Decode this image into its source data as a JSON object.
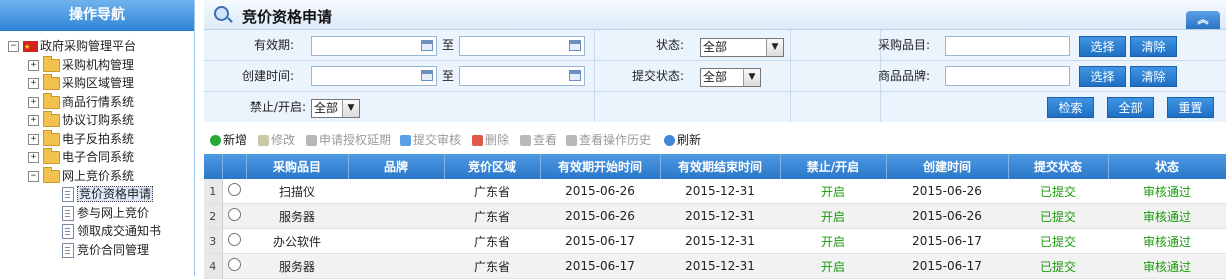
{
  "sidebar": {
    "title": "操作导航",
    "root": "政府采购管理平台",
    "items": [
      {
        "label": "采购机构管理"
      },
      {
        "label": "采购区域管理"
      },
      {
        "label": "商品行情系统"
      },
      {
        "label": "协议订购系统"
      },
      {
        "label": "电子反拍系统"
      },
      {
        "label": "电子合同系统"
      },
      {
        "label": "网上竞价系统"
      }
    ],
    "subitems": [
      {
        "label": "竞价资格申请"
      },
      {
        "label": "参与网上竞价"
      },
      {
        "label": "领取成交通知书"
      },
      {
        "label": "竞价合同管理"
      }
    ]
  },
  "header": {
    "title": "竞价资格申请",
    "collapse": "︽"
  },
  "form": {
    "valid_label": "有效期:",
    "to1": "至",
    "to2": "至",
    "status_label": "状态:",
    "status_value": "全部",
    "item_label": "采购品目:",
    "select_btn": "选择",
    "clear_btn": "清除",
    "created_label": "创建时间:",
    "submit_status_label": "提交状态:",
    "submit_status_value": "全部",
    "brand_label": "商品品牌:",
    "select_btn2": "选择",
    "clear_btn2": "清除",
    "toggle_label": "禁止/开启:",
    "toggle_value": "全部",
    "search_btn": "检索",
    "all_btn": "全部",
    "reset_btn": "重置"
  },
  "toolbar": {
    "add": "新增",
    "edit": "修改",
    "extend": "申请授权延期",
    "submit": "提交审核",
    "delete": "删除",
    "view": "查看",
    "history": "查看操作历史",
    "refresh": "刷新"
  },
  "table": {
    "headers": [
      "采购品目",
      "品牌",
      "竞价区域",
      "有效期开始时间",
      "有效期结束时间",
      "禁止/开启",
      "创建时间",
      "提交状态",
      "状态"
    ],
    "rows": [
      {
        "n": "1",
        "item": "扫描仪",
        "brand": "",
        "region": "广东省",
        "start": "2015-06-26",
        "end": "2015-12-31",
        "toggle": "开启",
        "created": "2015-06-26",
        "submit": "已提交",
        "status": "审核通过"
      },
      {
        "n": "2",
        "item": "服务器",
        "brand": "",
        "region": "广东省",
        "start": "2015-06-26",
        "end": "2015-12-31",
        "toggle": "开启",
        "created": "2015-06-26",
        "submit": "已提交",
        "status": "审核通过"
      },
      {
        "n": "3",
        "item": "办公软件",
        "brand": "",
        "region": "广东省",
        "start": "2015-06-17",
        "end": "2015-12-31",
        "toggle": "开启",
        "created": "2015-06-17",
        "submit": "已提交",
        "status": "审核通过"
      },
      {
        "n": "4",
        "item": "服务器",
        "brand": "",
        "region": "广东省",
        "start": "2015-06-17",
        "end": "2015-12-31",
        "toggle": "开启",
        "created": "2015-06-17",
        "submit": "已提交",
        "status": "审核通过"
      }
    ]
  },
  "colors": {
    "accent": "#2a77c9",
    "green": "#1a9b0c"
  }
}
